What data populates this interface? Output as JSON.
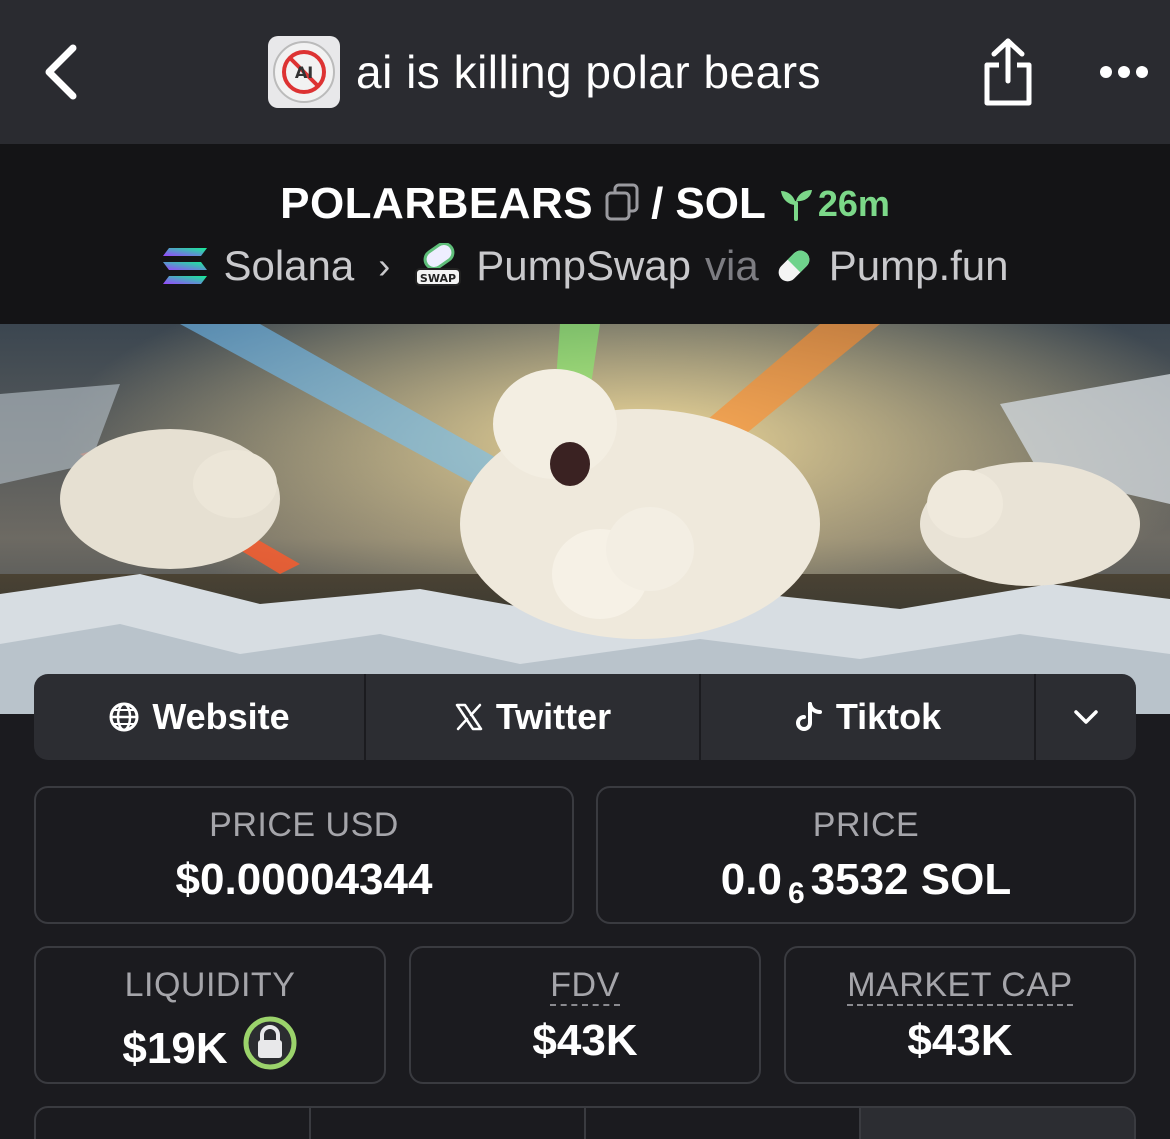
{
  "header": {
    "title": "ai is killing polar bears",
    "avatar_text": "AI"
  },
  "pair": {
    "base": "POLARBEARS",
    "separator": "/",
    "quote": "SOL",
    "age": "26m",
    "chain": "Solana",
    "dex": "PumpSwap",
    "via": "via",
    "launchpad": "Pump.fun",
    "dex_badge": "SWAP"
  },
  "links": {
    "website": "Website",
    "twitter": "Twitter",
    "tiktok": "Tiktok"
  },
  "stats": {
    "price_usd_label": "PRICE USD",
    "price_usd": "$0.00004344",
    "price_label": "PRICE",
    "price_prefix": "0.0",
    "price_zeros": "6",
    "price_digits": "3532 SOL",
    "liquidity_label": "LIQUIDITY",
    "liquidity": "$19K",
    "fdv_label": "FDV",
    "fdv": "$43K",
    "mcap_label": "MARKET CAP",
    "mcap": "$43K"
  },
  "colors": {
    "accent_green": "#7cd889",
    "lock_ring": "#9bd36b",
    "background": "#1b1b1f"
  },
  "icons": [
    "back-icon",
    "share-icon",
    "more-icon",
    "copy-icon",
    "sprout-icon",
    "solana-icon",
    "pumpswap-icon",
    "pill-icon",
    "globe-icon",
    "x-icon",
    "tiktok-icon",
    "chevron-down-icon",
    "lock-icon"
  ]
}
